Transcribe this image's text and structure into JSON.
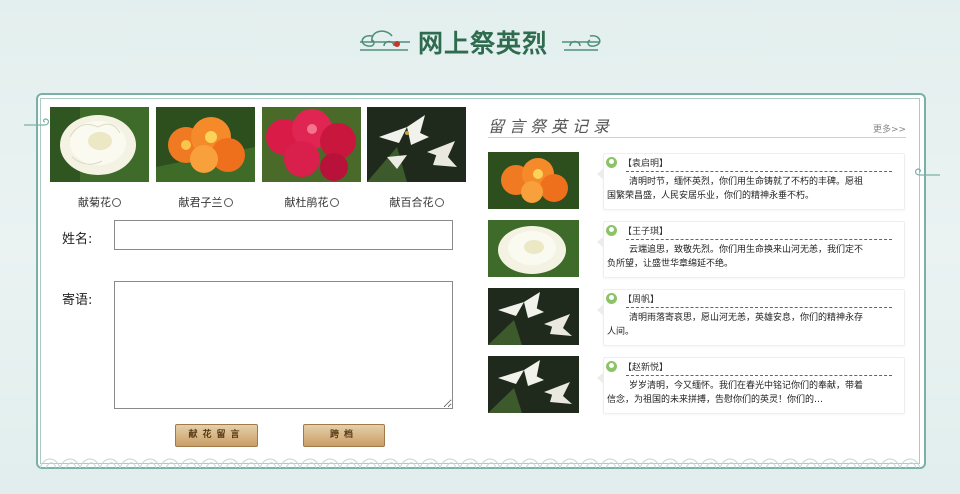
{
  "header": {
    "title": "网上祭英烈"
  },
  "flowers": [
    {
      "label": "献菊花",
      "icon": "white-chrysanthemum-photo"
    },
    {
      "label": "献君子兰",
      "icon": "orange-clivia-photo"
    },
    {
      "label": "献杜鹃花",
      "icon": "red-azalea-photo"
    },
    {
      "label": "献百合花",
      "icon": "white-lily-photo"
    }
  ],
  "form": {
    "name_label": "姓名:",
    "name_value": "",
    "message_label": "寄语:",
    "message_value": "",
    "submit_label": "献花留言",
    "reset_label": "跨档"
  },
  "messages_section": {
    "title": "留言祭英记录",
    "more_label": "更多>>",
    "items": [
      {
        "author": "【袁启明】",
        "thumb": "orange-clivia-photo",
        "text": "清明时节，缅怀英烈，你们用生命铸就了不朽的丰碑。愿祖国繁荣昌盛，人民安居乐业，你们的精神永垂不朽。"
      },
      {
        "author": "【王子琪】",
        "thumb": "white-chrysanthemum-photo",
        "text": "云端追思，致敬先烈。你们用生命换来山河无恙，我们定不负所望，让盛世华章绵延不绝。"
      },
      {
        "author": "【周帆】",
        "thumb": "white-lily-photo",
        "text": "清明雨落寄哀思，愿山河无恙，英雄安息，你们的精神永存人间。"
      },
      {
        "author": "【赵新悦】",
        "thumb": "white-lily-photo",
        "text": "岁岁清明，今又缅怀。我们在春光中铭记你们的奉献，带着信念，为祖国的未来拼搏，告慰你们的英灵！你们的…"
      }
    ]
  },
  "colors": {
    "brand_green": "#2f6b4f",
    "frame_border": "#7cb0a6",
    "button_gold": "#c89e66",
    "user_icon_green": "#8cc36a"
  }
}
